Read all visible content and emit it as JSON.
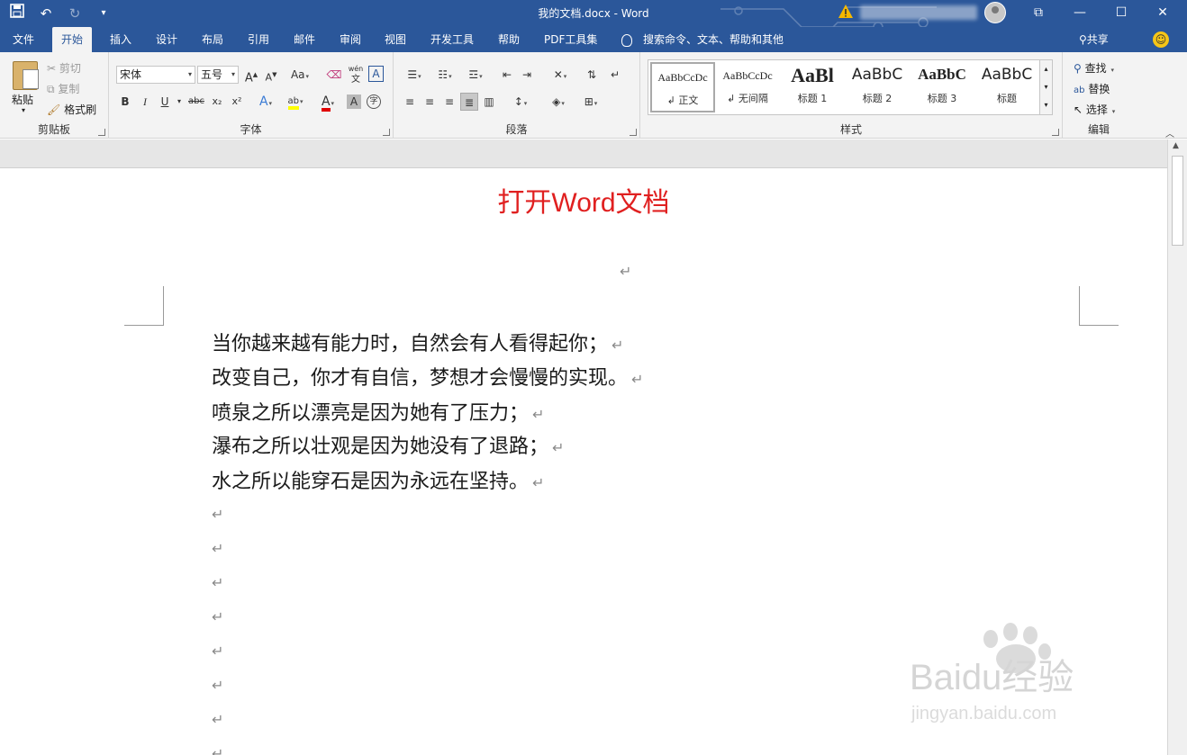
{
  "window": {
    "title": "我的文档.docx  -  Word",
    "controls": {
      "ribbon_display": "⧉",
      "minimize": "—",
      "maximize": "☐",
      "close": "✕"
    }
  },
  "qat": {
    "save_icon": "save-icon",
    "undo_icon": "undo-icon",
    "redo_icon": "redo-icon",
    "customize_icon": "chevron-down-icon"
  },
  "tabs": [
    {
      "label": "文件"
    },
    {
      "label": "开始"
    },
    {
      "label": "插入"
    },
    {
      "label": "设计"
    },
    {
      "label": "布局"
    },
    {
      "label": "引用"
    },
    {
      "label": "邮件"
    },
    {
      "label": "审阅"
    },
    {
      "label": "视图"
    },
    {
      "label": "开发工具"
    },
    {
      "label": "帮助"
    },
    {
      "label": "PDF工具集"
    }
  ],
  "active_tab": "开始",
  "tell_me": "搜索命令、文本、帮助和其他",
  "share": "共享",
  "clipboard": {
    "paste": "粘贴",
    "cut": "剪切",
    "copy": "复制",
    "format_painter": "格式刷",
    "label": "剪贴板"
  },
  "font": {
    "name": "宋体",
    "size": "五号",
    "label": "字体",
    "grow": "A",
    "shrink": "A",
    "case": "Aa",
    "pinyin_top": "wén",
    "pinyin_bottom": "文",
    "border_char": "A",
    "bold": "B",
    "italic": "I",
    "underline": "U",
    "strike": "abc",
    "sub": "x₂",
    "sup": "x²",
    "effects": "A",
    "highlight": "ab",
    "color": "A",
    "shade": "A",
    "enclose": "字"
  },
  "paragraph": {
    "label": "段落"
  },
  "styles": {
    "label": "样式",
    "items": [
      {
        "sample": "AaBbCcDc",
        "name": "↲ 正文"
      },
      {
        "sample": "AaBbCcDc",
        "name": "↲ 无间隔"
      },
      {
        "sample": "AaBl",
        "name": "标题 1"
      },
      {
        "sample": "AaBbC",
        "name": "标题 2"
      },
      {
        "sample": "AaBbC",
        "name": "标题 3"
      },
      {
        "sample": "AaBbC",
        "name": "标题"
      }
    ]
  },
  "editing": {
    "find": "查找",
    "replace": "替换",
    "select": "选择",
    "label": "编辑"
  },
  "document": {
    "headline": "打开Word文档",
    "return_mark": "↵",
    "lines": [
      "当你越来越有能力时，自然会有人看得起你；",
      "改变自己，你才有自信，梦想才会慢慢的实现。",
      "喷泉之所以漂亮是因为她有了压力；",
      "瀑布之所以壮观是因为她没有了退路；",
      "水之所以能穿石是因为永远在坚持。"
    ]
  },
  "watermark": {
    "brand": "Baidu经验",
    "url": "jingyan.baidu.com"
  },
  "colors": {
    "title_bar": "#2b579a",
    "ribbon": "#f3f3f3",
    "headline": "#e02020"
  }
}
